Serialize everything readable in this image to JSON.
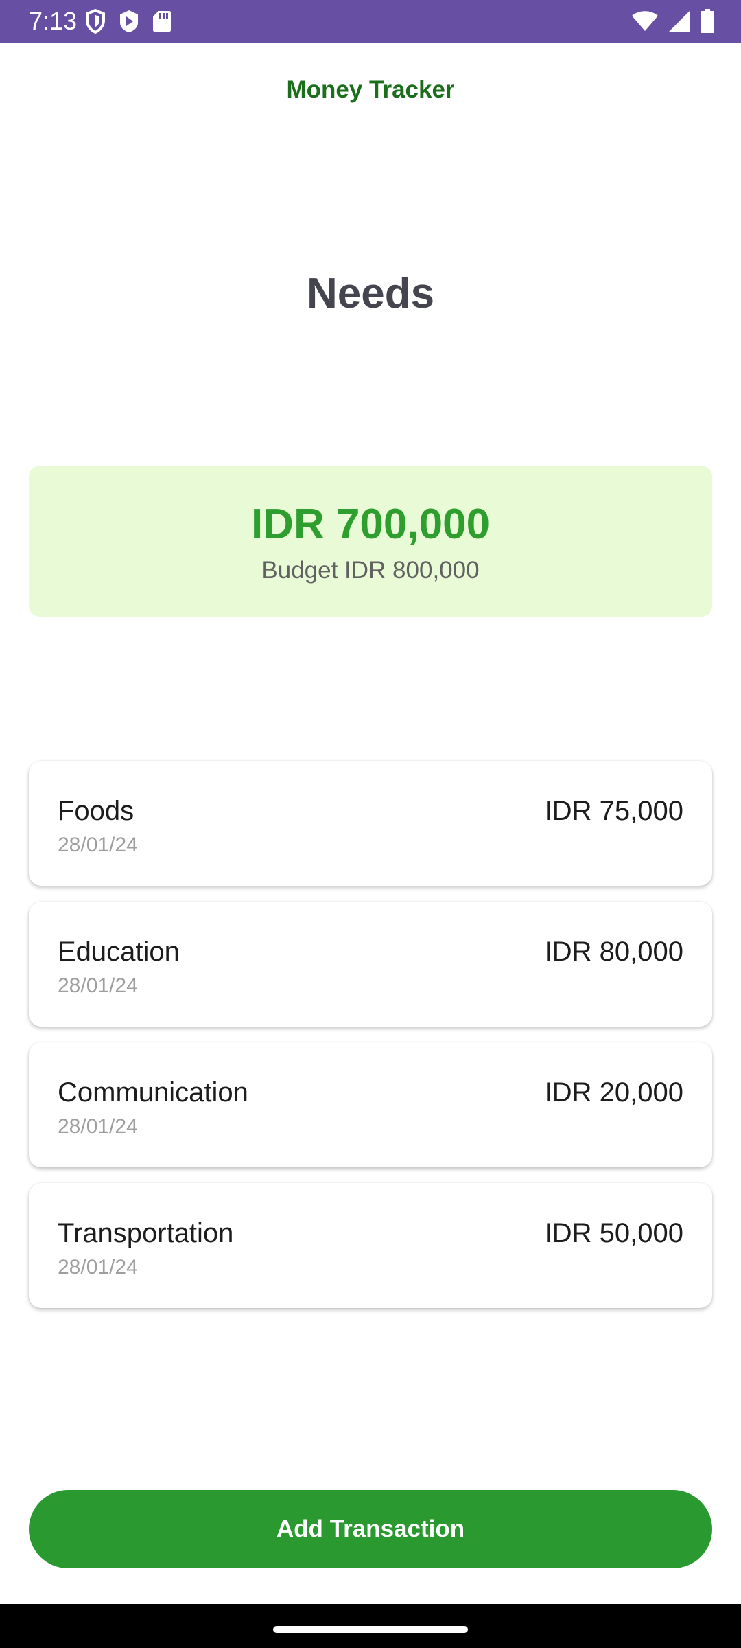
{
  "status_bar": {
    "time": "7:13",
    "background": "#6750a4",
    "left_icons": [
      "shield-icon",
      "play-icon",
      "sd-card-icon"
    ],
    "right_icons": [
      "wifi-icon",
      "signal-icon",
      "battery-icon"
    ]
  },
  "header": {
    "app_title": "Money Tracker",
    "title_color": "#1b6e1b"
  },
  "page": {
    "heading": "Needs"
  },
  "summary": {
    "amount": "IDR 700,000",
    "budget": "Budget IDR 800,000",
    "background": "#e9fad6",
    "amount_color": "#2e9e2e"
  },
  "transactions": [
    {
      "category": "Foods",
      "date": "28/01/24",
      "amount": "IDR 75,000"
    },
    {
      "category": "Education",
      "date": "28/01/24",
      "amount": "IDR 80,000"
    },
    {
      "category": "Communication",
      "date": "28/01/24",
      "amount": "IDR 20,000"
    },
    {
      "category": "Transportation",
      "date": "28/01/24",
      "amount": "IDR 50,000"
    }
  ],
  "actions": {
    "add_label": "Add Transaction",
    "button_color": "#2a9a30"
  }
}
